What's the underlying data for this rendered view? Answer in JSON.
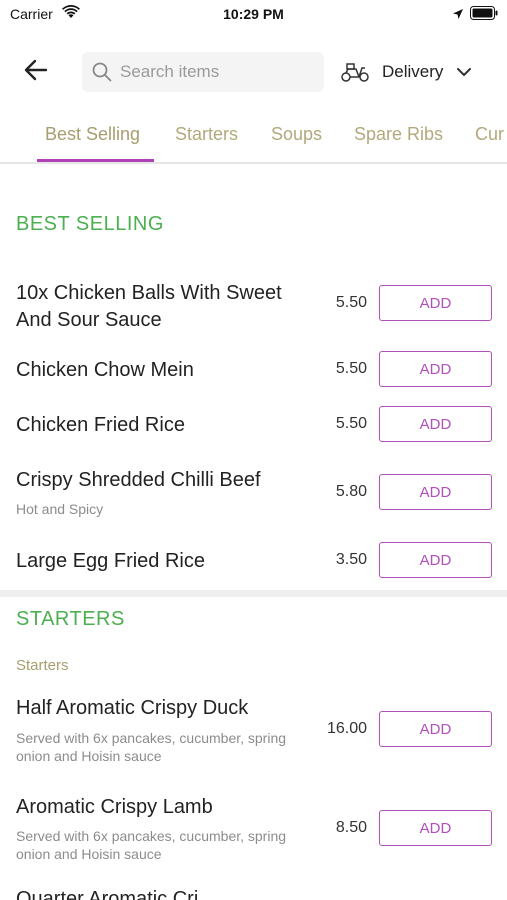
{
  "status_bar": {
    "carrier": "Carrier",
    "time": "10:29 PM"
  },
  "header": {
    "search_placeholder": "Search items",
    "delivery_label": "Delivery",
    "icons": {
      "back": "back-arrow-icon",
      "search": "search-icon",
      "delivery": "scooter-icon",
      "dropdown": "chevron-down-icon"
    }
  },
  "tabs": [
    {
      "label": "Best Selling",
      "active": true
    },
    {
      "label": "Starters",
      "active": false
    },
    {
      "label": "Soups",
      "active": false
    },
    {
      "label": "Spare Ribs",
      "active": false
    },
    {
      "label": "Cur",
      "active": false
    }
  ],
  "sections": {
    "best_selling": {
      "title": "BEST SELLING",
      "items": [
        {
          "name": "10x Chicken Balls With Sweet And Sour Sauce",
          "price": "5.50",
          "add_label": "ADD"
        },
        {
          "name": "Chicken Chow Mein",
          "price": "5.50",
          "add_label": "ADD"
        },
        {
          "name": "Chicken Fried Rice",
          "price": "5.50",
          "add_label": "ADD"
        },
        {
          "name": "Crispy Shredded Chilli Beef",
          "description": "Hot and Spicy",
          "price": "5.80",
          "add_label": "ADD"
        },
        {
          "name": "Large Egg Fried Rice",
          "price": "3.50",
          "add_label": "ADD"
        }
      ]
    },
    "starters": {
      "title": "STARTERS",
      "subcategory": "Starters",
      "items": [
        {
          "name": "Half Aromatic Crispy Duck",
          "description": "Served with 6x pancakes, cucumber, spring onion and Hoisin sauce",
          "price": "16.00",
          "add_label": "ADD"
        },
        {
          "name": "Aromatic Crispy Lamb",
          "description": "Served with 6x pancakes, cucumber, spring onion and Hoisin sauce",
          "price": "8.50",
          "add_label": "ADD"
        }
      ],
      "partial_next_item": "Quarter Aromatic Cri"
    }
  },
  "colors": {
    "accent": "#b050b8",
    "section_title": "#4caf50",
    "tab_text": "#b3a87c"
  }
}
